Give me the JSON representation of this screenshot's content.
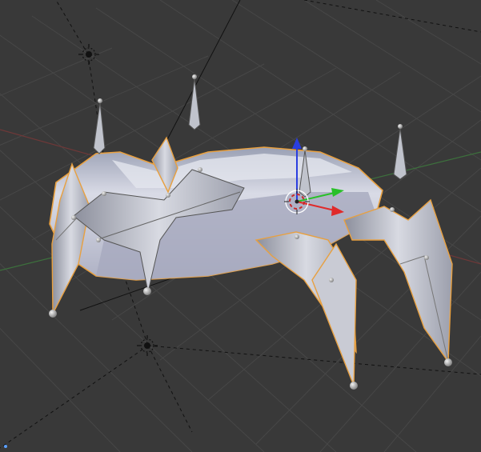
{
  "colors": {
    "background": "#393939",
    "grid": "#4a4a4a",
    "x_axis": "#7a3b3b",
    "y_axis": "#3f7a3f",
    "selection_outline": "#e8a040",
    "mesh_fill": "#c4c7d4",
    "bone_fill": "#b9bcc6"
  },
  "icons": {
    "light": "light-lamp-icon",
    "cursor": "3d-cursor-icon",
    "manipulator": "transform-manipulator-icon"
  }
}
